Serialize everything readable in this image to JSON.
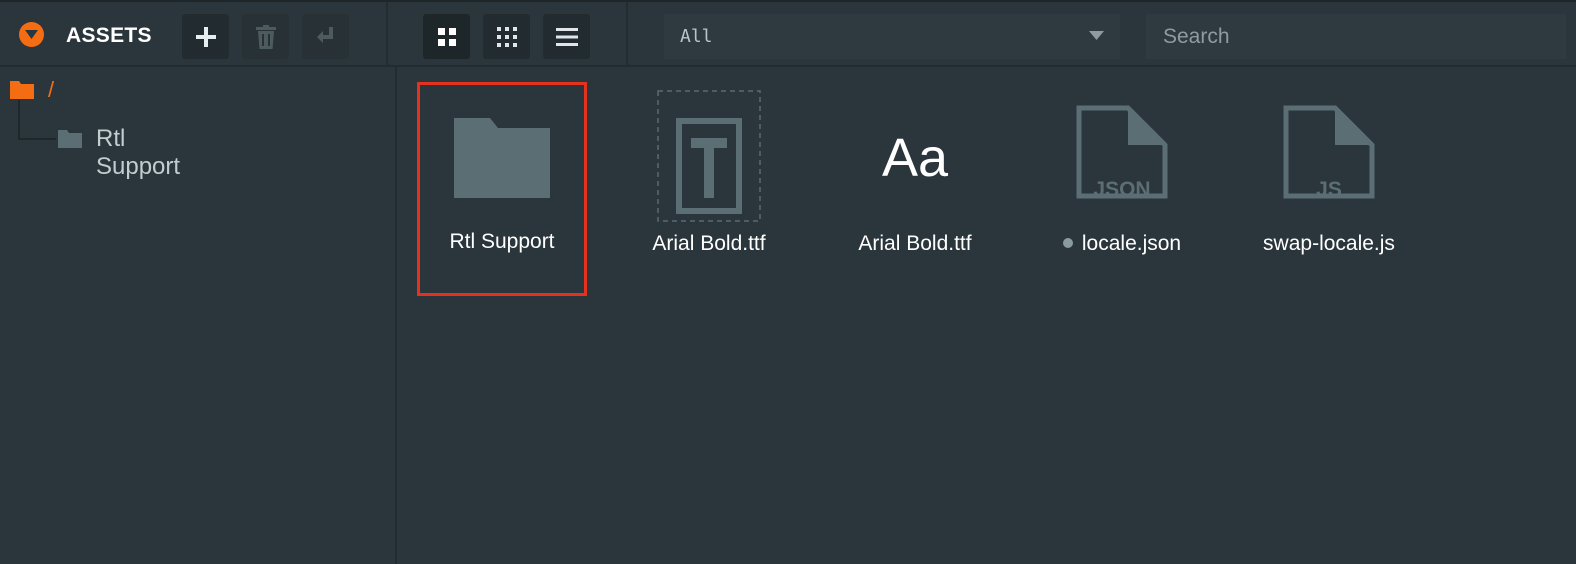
{
  "header": {
    "title": "ASSETS",
    "filter": {
      "selected": "All"
    },
    "search": {
      "placeholder": "Search"
    }
  },
  "colors": {
    "accent": "#f46d12",
    "selection": "#e5321e",
    "background": "#2b363c"
  },
  "icons": {
    "collapse": "chevron-down-icon",
    "add": "plus-icon",
    "delete": "trash-icon",
    "move": "move-icon",
    "grid_large": "grid-large-icon",
    "grid_small": "grid-small-icon",
    "list": "list-icon"
  },
  "tree": {
    "root": {
      "label": "/"
    },
    "children": [
      {
        "label": "Rtl Support"
      }
    ]
  },
  "assets": [
    {
      "label": "Rtl Support",
      "type": "folder",
      "selected": true
    },
    {
      "label": "Arial Bold.ttf",
      "type": "font-text"
    },
    {
      "label": "Arial Bold.ttf",
      "type": "font",
      "glyph": "Aa"
    },
    {
      "label": "locale.json",
      "type": "json",
      "file_badge": "JSON",
      "modified_dot": true
    },
    {
      "label": "swap-locale.js",
      "type": "script",
      "file_badge": "JS"
    }
  ]
}
